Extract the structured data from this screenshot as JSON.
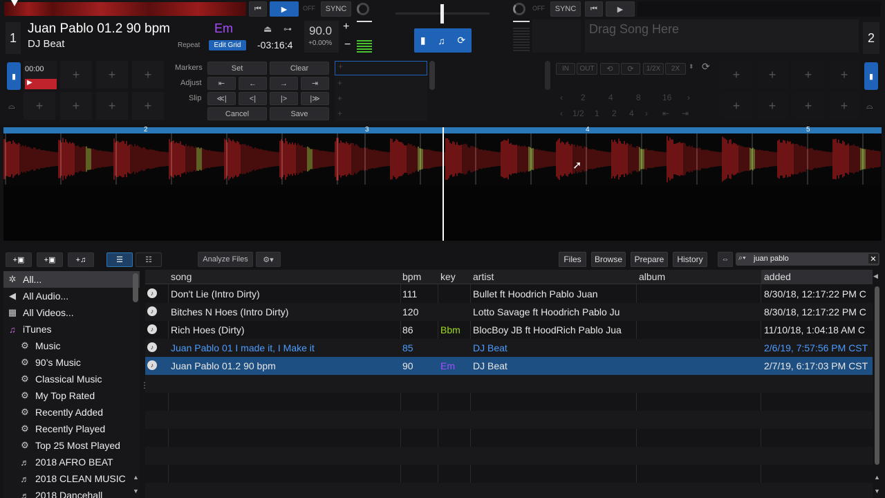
{
  "deck1": {
    "number": "1",
    "title": "Juan Pablo 01.2 90 bpm",
    "artist": "DJ Beat",
    "key": "Em",
    "repeat_label": "Repeat",
    "edit_grid_label": "Edit Grid",
    "time_remaining": "-03:16:4",
    "bpm": "90.0",
    "pitch": "+0.00%",
    "off_label": "OFF",
    "sync_label": "SYNC",
    "cue_time": "00:00"
  },
  "deck2": {
    "number": "2",
    "placeholder": "Drag Song Here",
    "off_label": "OFF",
    "sync_label": "SYNC"
  },
  "markers": {
    "markers_label": "Markers",
    "adjust_label": "Adjust",
    "slip_label": "Slip",
    "set_label": "Set",
    "clear_label": "Clear",
    "cancel_label": "Cancel",
    "save_label": "Save",
    "adjust_buttons": [
      "⇤",
      "←",
      "→",
      "⇥"
    ],
    "slip_buttons": [
      "≪|",
      "<|",
      "|>",
      "|≫"
    ]
  },
  "loop": {
    "in_label": "IN",
    "out_label": "OUT",
    "half_label": "1/2X",
    "double_label": "2X",
    "row1": [
      "2",
      "4",
      "8",
      "16"
    ],
    "row2": [
      "1/2",
      "1",
      "2",
      "4"
    ]
  },
  "beats": [
    "2",
    "3",
    "4",
    "5"
  ],
  "toolbar": {
    "analyze_label": "Analyze Files",
    "files_tab": "Files",
    "browse_tab": "Browse",
    "prepare_tab": "Prepare",
    "history_tab": "History",
    "search_value": "juan pablo"
  },
  "sidebar": {
    "items": [
      {
        "label": "All...",
        "icon": "asterisk-icon"
      },
      {
        "label": "All Audio...",
        "icon": "speaker-icon"
      },
      {
        "label": "All Videos...",
        "icon": "film-icon"
      },
      {
        "label": "iTunes",
        "icon": "itunes-icon"
      },
      {
        "label": "Music",
        "icon": "gear-icon"
      },
      {
        "label": "90’s Music",
        "icon": "gear-icon"
      },
      {
        "label": "Classical Music",
        "icon": "gear-icon"
      },
      {
        "label": "My Top Rated",
        "icon": "gear-icon"
      },
      {
        "label": "Recently Added",
        "icon": "gear-icon"
      },
      {
        "label": "Recently Played",
        "icon": "gear-icon"
      },
      {
        "label": "Top 25 Most Played",
        "icon": "gear-icon"
      },
      {
        "label": "2018 AFRO BEAT",
        "icon": "playlist-icon"
      },
      {
        "label": "2018 CLEAN MUSIC",
        "icon": "playlist-icon"
      },
      {
        "label": "2018 Dancehall",
        "icon": "playlist-icon"
      }
    ]
  },
  "table": {
    "columns": {
      "song": "song",
      "bpm": "bpm",
      "key": "key",
      "artist": "artist",
      "album": "album",
      "added": "added"
    },
    "rows": [
      {
        "song": "Don't Lie (Intro Dirty)",
        "bpm": "111",
        "key": "",
        "artist": "Bullet ft Hoodrich Pablo Juan",
        "album": "",
        "added": "8/30/18, 12:17:22 PM C"
      },
      {
        "song": "Bitches N Hoes (Intro Dirty)",
        "bpm": "120",
        "key": "",
        "artist": "Lotto Savage ft Hoodrich Pablo Ju",
        "album": "",
        "added": "8/30/18, 12:17:22 PM C"
      },
      {
        "song": "Rich Hoes (Dirty)",
        "bpm": "86",
        "key": "Bbm",
        "artist": "BlocBoy JB ft HoodRich Pablo Jua",
        "album": "",
        "added": "11/10/18, 1:04:18 AM C"
      },
      {
        "song": "Juan Pablo 01 I made it, I Make it",
        "bpm": "85",
        "key": "",
        "artist": "DJ Beat",
        "album": "",
        "added": "2/6/19, 7:57:56 PM CST"
      },
      {
        "song": "Juan Pablo 01.2 90 bpm",
        "bpm": "90",
        "key": "Em",
        "artist": "DJ Beat",
        "album": "",
        "added": "2/7/19, 6:17:03 PM CST"
      }
    ]
  },
  "colors": {
    "accent": "#1e63b8",
    "key_em": "#a64dff",
    "key_bbm": "#9fdc1c",
    "blue_text": "#4a9cff"
  }
}
